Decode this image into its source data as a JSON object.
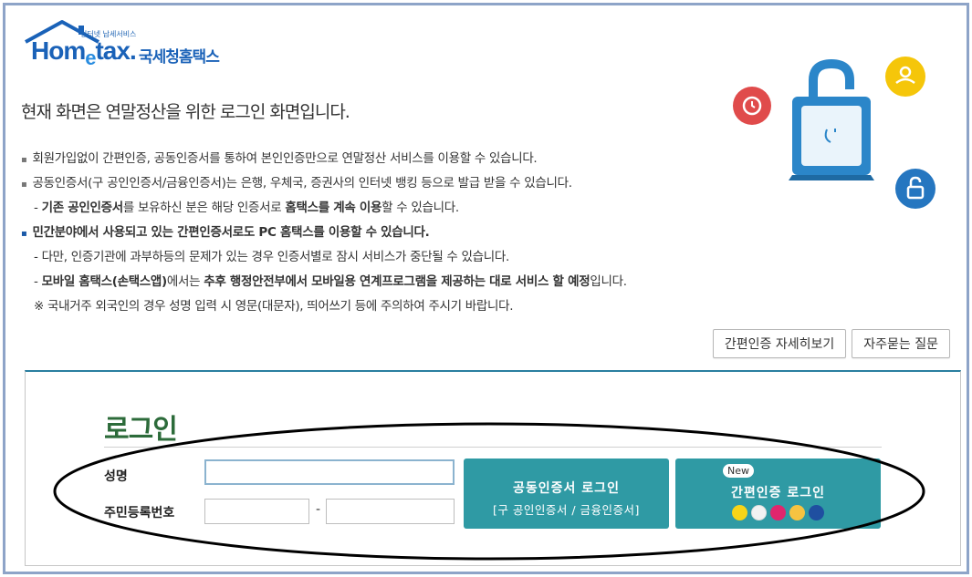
{
  "logo": {
    "small_text": "인터넷 납세서비스",
    "brand_prefix": "Hom",
    "brand_e": "e",
    "brand_suffix": "tax.",
    "brand_kr": "국세청홈택스"
  },
  "page_title": "현재 화면은 연말정산을 위한 로그인 화면입니다.",
  "notices": {
    "line1": "회원가입없이 간편인증, 공동인증서를 통하여 본인인증만으로 연말정산 서비스를 이용할 수 있습니다.",
    "line2": "공동인증서(구 공인인증서/금융인증서)는 은행, 우체국, 증권사의 인터넷 뱅킹 등으로 발급 받을 수 있습니다.",
    "line3_a": "- ",
    "line3_b": "기존 공인인증서",
    "line3_c": "를 보유하신 분은 해당 인증서로 ",
    "line3_d": "홈택스를 계속 이용",
    "line3_e": "할 수 있습니다.",
    "line4": "민간분야에서 사용되고 있는 간편인증서로도 PC 홈택스를 이용할 수 있습니다.",
    "line5": "- 다만, 인증기관에 과부하등의 문제가 있는 경우 인증서별로 잠시 서비스가 중단될 수 있습니다.",
    "line6_a": "- ",
    "line6_b": "모바일 홈택스(손택스앱)",
    "line6_c": "에서는 ",
    "line6_d": "추후 행정안전부에서 모바일용 연계프로그램을 제공하는 대로 서비스 할 예정",
    "line6_e": "입니다.",
    "line7": "※ 국내거주 외국인의 경우 성명 입력 시 영문(대문자), 띄어쓰기 등에 주의하여 주시기 바랍니다."
  },
  "buttons": {
    "simple_auth_detail": "간편인증 자세히보기",
    "faq": "자주묻는 질문"
  },
  "login": {
    "title": "로그인",
    "name_label": "성명",
    "rrn_label": "주민등록번호",
    "dash": "-",
    "name_value": "",
    "rrn_front_value": "",
    "rrn_back_value": "",
    "cert_button_title": "공동인증서 로그인",
    "cert_button_sub": "[구 공인인증서 / 금융인증서]",
    "simple_button_badge": "New",
    "simple_button_title": "간편인증 로그인"
  },
  "colors": {
    "accent_teal": "#2f9aa4",
    "login_title_green": "#2c6b3a",
    "brand_blue": "#1a62b8",
    "notice_blue": "#1b5aa8"
  },
  "simple_auth_icons": [
    "kakao-icon",
    "payco-icon",
    "pass-icon",
    "kb-icon",
    "samsung-pass-icon"
  ]
}
